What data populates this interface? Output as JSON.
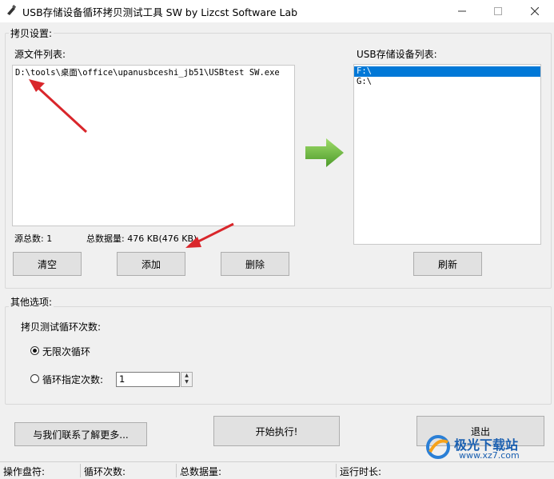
{
  "window": {
    "title": "USB存储设备循环拷贝测试工具 SW  by Lizcst Software Lab",
    "minimize_icon": "minimize-icon",
    "maximize_icon": "maximize-icon",
    "close_icon": "close-icon"
  },
  "copy_settings": {
    "group_label": "拷贝设置:",
    "source_list_label": "源文件列表:",
    "source_files": [
      "D:\\tools\\桌面\\office\\upanusbceshi_jb51\\USBtest SW.exe"
    ],
    "source_count": "源总数: 1",
    "total_data": "总数据量: 476 KB(476 KB)",
    "buttons": {
      "clear": "清空",
      "add": "添加",
      "delete": "删除"
    },
    "usb_list_label": "USB存储设备列表:",
    "usb_devices": [
      "F:\\",
      "G:\\"
    ],
    "selected_device": "F:\\",
    "refresh": "刷新",
    "arrow_color": "#6ab83a"
  },
  "other_options": {
    "group_label": "其他选项:",
    "loop_label": "拷贝测试循环次数:",
    "infinite_label": "无限次循环",
    "specified_label": "循环指定次数:",
    "count_value": "1",
    "selected": "infinite"
  },
  "actions": {
    "contact": "与我们联系了解更多...",
    "start": "开始执行!",
    "exit": "退出"
  },
  "status": {
    "drive": "操作盘符:",
    "loops": "循环次数:",
    "total": "总数据量:",
    "runtime": "运行时长:"
  },
  "watermark": {
    "name": "极光下载站",
    "url": "www.xz7.com"
  },
  "colors": {
    "annotation_arrow": "#d9262b",
    "selection": "#0078d7"
  }
}
